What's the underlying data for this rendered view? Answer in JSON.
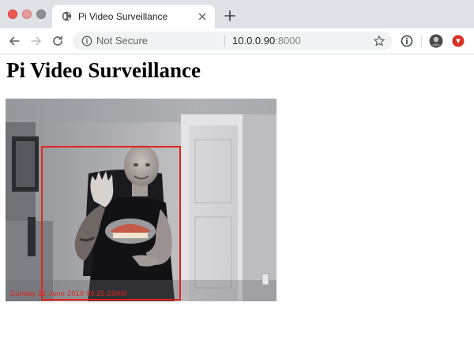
{
  "window": {
    "tab": {
      "title": "Pi Video Surveillance",
      "favicon_icon": "globe-icon"
    }
  },
  "toolbar": {
    "security_label": "Not Secure",
    "url_host": "10.0.0.90",
    "url_port": ":8000"
  },
  "page": {
    "title": "Pi Video Surveillance",
    "video": {
      "overlay_timestamp": "Sunday 22 June 2019 09:25:29AM",
      "detection_color": "#e0261b"
    }
  },
  "colors": {
    "tabstrip": "#dee1e6",
    "close_button": "#ee5a52",
    "accent_record": "#e0261b"
  }
}
